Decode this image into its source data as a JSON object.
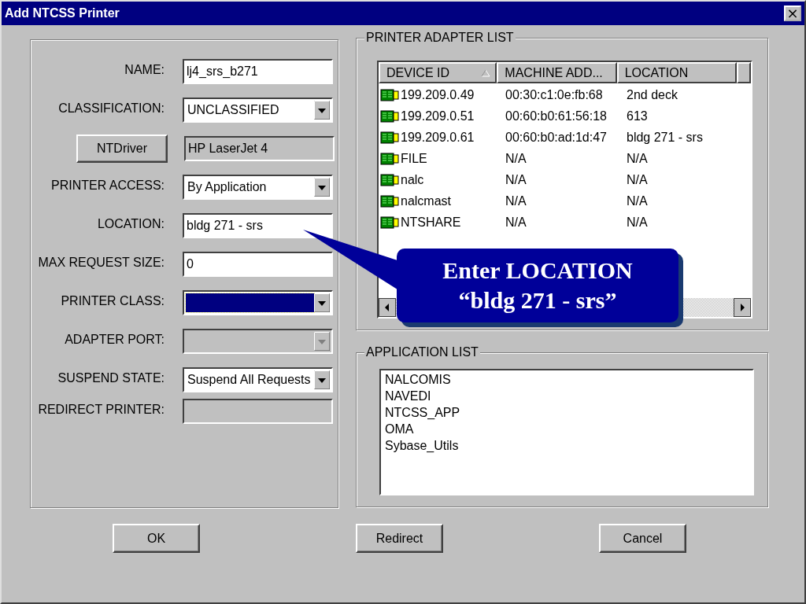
{
  "window": {
    "title": "Add NTCSS Printer",
    "close": "×"
  },
  "fields": [
    {
      "kind": "text",
      "label": "NAME:",
      "value": "lj4_srs_b271",
      "disabled": false
    },
    {
      "kind": "combo",
      "label": "CLASSIFICATION:",
      "value": "UNCLASSIFIED",
      "disabled": false,
      "focused": false
    },
    {
      "kind": "button",
      "label": "NTDriver",
      "value": "HP LaserJet 4",
      "disabled": true
    },
    {
      "kind": "combo",
      "label": "PRINTER ACCESS:",
      "value": "By Application",
      "disabled": false,
      "focused": false
    },
    {
      "kind": "text",
      "label": "LOCATION:",
      "value": "bldg 271 - srs",
      "disabled": false
    },
    {
      "kind": "text",
      "label": "MAX REQUEST SIZE:",
      "value": "0",
      "disabled": false
    },
    {
      "kind": "combo",
      "label": "PRINTER CLASS:",
      "disabled": false,
      "focused": true
    },
    {
      "kind": "combo",
      "label": "ADAPTER PORT:",
      "disabled": true,
      "focused": false
    },
    {
      "kind": "combo",
      "label": "SUSPEND STATE:",
      "value": "Suspend All Requests",
      "disabled": false,
      "focused": false
    },
    {
      "kind": "text",
      "label": "REDIRECT PRINTER:",
      "disabled": true
    }
  ],
  "adapter_list": {
    "title": "PRINTER ADAPTER LIST",
    "columns": [
      {
        "label": "DEVICE ID",
        "sorted": true
      },
      {
        "label": "MACHINE ADD...",
        "sorted": false
      },
      {
        "label": "LOCATION",
        "sorted": false
      }
    ],
    "rows": [
      [
        "199.209.0.49",
        "00:30:c1:0e:fb:68",
        "2nd deck"
      ],
      [
        "199.209.0.51",
        "00:60:b0:61:56:18",
        "613"
      ],
      [
        "199.209.0.61",
        "00:60:b0:ad:1d:47",
        "bldg 271 - srs"
      ],
      [
        "FILE",
        "N/A",
        "N/A"
      ],
      [
        "nalc",
        "N/A",
        "N/A"
      ],
      [
        "nalcmast",
        "N/A",
        "N/A"
      ],
      [
        "NTSHARE",
        "N/A",
        "N/A"
      ]
    ]
  },
  "application_list": {
    "title": "APPLICATION LIST",
    "items": [
      "NALCOMIS",
      "NAVEDI",
      "NTCSS_APP",
      "OMA",
      "Sybase_Utils"
    ]
  },
  "buttons": [
    "OK",
    "Redirect",
    "Cancel"
  ],
  "callout": {
    "lines": [
      "Enter LOCATION",
      "“bldg 271 - srs”"
    ]
  }
}
